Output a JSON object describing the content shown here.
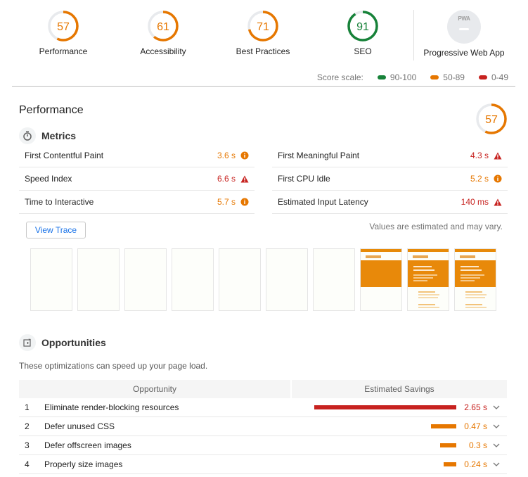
{
  "colors": {
    "pass": "#178239",
    "average": "#e67700",
    "fail": "#c7221f",
    "track": "#e8eaed",
    "link": "#1a73e8"
  },
  "categories": [
    {
      "label": "Performance",
      "score": 57,
      "rating": "average"
    },
    {
      "label": "Accessibility",
      "score": 61,
      "rating": "average"
    },
    {
      "label": "Best Practices",
      "score": 71,
      "rating": "average"
    },
    {
      "label": "SEO",
      "score": 91,
      "rating": "pass"
    }
  ],
  "pwa": {
    "label": "Progressive Web App",
    "badge_text": "PWA",
    "icon": "pwa-badge-icon"
  },
  "score_scale": {
    "label": "Score scale:",
    "ranges": [
      {
        "label": "90-100",
        "rating": "pass"
      },
      {
        "label": "50-89",
        "rating": "average"
      },
      {
        "label": "0-49",
        "rating": "fail"
      }
    ]
  },
  "performance": {
    "title": "Performance",
    "score": 57,
    "rating": "average",
    "metrics_title": "Metrics",
    "metrics_icon": "stopwatch-icon",
    "metrics": {
      "left": [
        {
          "name": "First Contentful Paint",
          "value": "3.6 s",
          "rating": "average",
          "icon": "info-icon"
        },
        {
          "name": "Speed Index",
          "value": "6.6 s",
          "rating": "fail",
          "icon": "warning-icon"
        },
        {
          "name": "Time to Interactive",
          "value": "5.7 s",
          "rating": "average",
          "icon": "info-icon"
        }
      ],
      "right": [
        {
          "name": "First Meaningful Paint",
          "value": "4.3 s",
          "rating": "fail",
          "icon": "warning-icon"
        },
        {
          "name": "First CPU Idle",
          "value": "5.2 s",
          "rating": "average",
          "icon": "info-icon"
        },
        {
          "name": "Estimated Input Latency",
          "value": "140 ms",
          "rating": "fail",
          "icon": "warning-icon"
        }
      ]
    },
    "view_trace_label": "View Trace",
    "estimate_note": "Values are estimated and may vary.",
    "filmstrip": [
      {
        "state": "blank"
      },
      {
        "state": "blank"
      },
      {
        "state": "blank"
      },
      {
        "state": "blank"
      },
      {
        "state": "blank"
      },
      {
        "state": "blank"
      },
      {
        "state": "blank"
      },
      {
        "state": "partial"
      },
      {
        "state": "loaded"
      },
      {
        "state": "loaded"
      }
    ]
  },
  "opportunities": {
    "title": "Opportunities",
    "icon": "opportunity-icon",
    "description": "These optimizations can speed up your page load.",
    "columns": [
      "Opportunity",
      "Estimated Savings"
    ],
    "max_savings_s": 2.65,
    "rows": [
      {
        "num": "1",
        "title": "Eliminate render-blocking resources",
        "savings": "2.65 s",
        "savings_s": 2.65,
        "rating": "fail"
      },
      {
        "num": "2",
        "title": "Defer unused CSS",
        "savings": "0.47 s",
        "savings_s": 0.47,
        "rating": "average"
      },
      {
        "num": "3",
        "title": "Defer offscreen images",
        "savings": "0.3 s",
        "savings_s": 0.3,
        "rating": "average"
      },
      {
        "num": "4",
        "title": "Properly size images",
        "savings": "0.24 s",
        "savings_s": 0.24,
        "rating": "average"
      }
    ]
  }
}
